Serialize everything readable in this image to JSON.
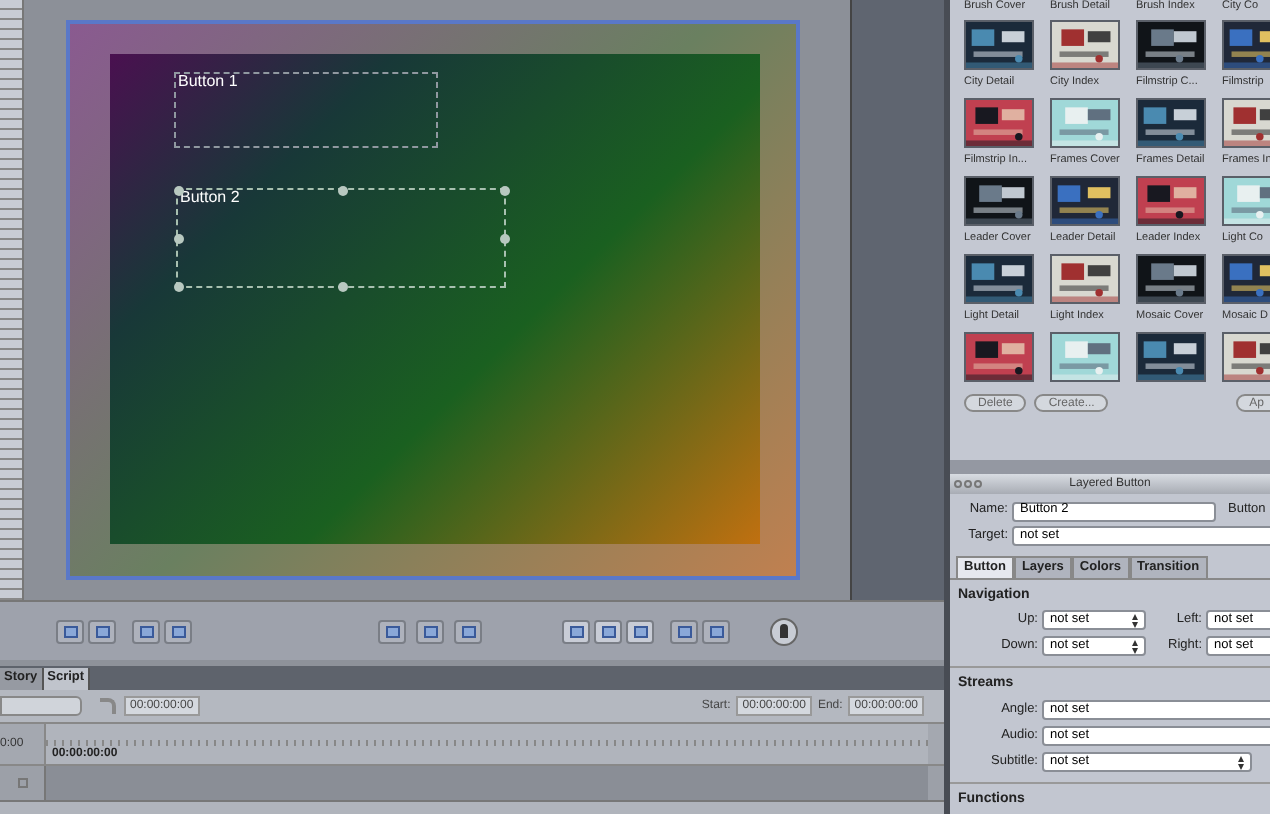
{
  "canvas": {
    "buttons": [
      {
        "label": "Button 1",
        "selected": false
      },
      {
        "label": "Button 2",
        "selected": true
      }
    ]
  },
  "timeline": {
    "tabs": [
      {
        "label": "Story",
        "selected": false
      },
      {
        "label": "Script",
        "selected": true
      }
    ],
    "timecode": "00:00:00:00",
    "start_label": "Start:",
    "start": "00:00:00:00",
    "end_label": "End:",
    "end": "00:00:00:00",
    "ruler_start": "0:00",
    "marker": "00:00:00:00"
  },
  "templates": {
    "header_labels": [
      "Brush Cover",
      "Brush Detail",
      "Brush Index",
      "City Co"
    ],
    "items": [
      {
        "kind": "labeled",
        "label": "City Detail"
      },
      {
        "kind": "labeled",
        "label": "City Index"
      },
      {
        "kind": "labeled",
        "label": "Filmstrip C..."
      },
      {
        "kind": "labeled",
        "label": "Filmstrip"
      },
      {
        "kind": "labeled",
        "label": "Filmstrip In..."
      },
      {
        "kind": "labeled",
        "label": "Frames Cover"
      },
      {
        "kind": "labeled",
        "label": "Frames Detail"
      },
      {
        "kind": "labeled",
        "label": "Frames In"
      },
      {
        "kind": "labeled",
        "label": "Leader Cover"
      },
      {
        "kind": "labeled",
        "label": "Leader Detail"
      },
      {
        "kind": "labeled",
        "label": "Leader Index"
      },
      {
        "kind": "labeled",
        "label": "Light Co"
      },
      {
        "kind": "labeled",
        "label": "Light Detail"
      },
      {
        "kind": "labeled",
        "label": "Light Index"
      },
      {
        "kind": "labeled",
        "label": "Mosaic Cover"
      },
      {
        "kind": "labeled",
        "label": "Mosaic D"
      },
      {
        "kind": "picture"
      },
      {
        "kind": "picture"
      },
      {
        "kind": "picture"
      },
      {
        "kind": "picture"
      }
    ],
    "buttons": [
      "Delete",
      "Create...",
      "Ap"
    ]
  },
  "inspector": {
    "title": "Layered Button",
    "name_label": "Name:",
    "name": "Button 2",
    "type_label": "Button",
    "target_label": "Target:",
    "target": "not set",
    "tabs": [
      {
        "label": "Button",
        "selected": true
      },
      {
        "label": "Layers",
        "selected": false
      },
      {
        "label": "Colors",
        "selected": false
      },
      {
        "label": "Transition",
        "selected": false
      }
    ],
    "navigation": {
      "title": "Navigation",
      "up_label": "Up:",
      "up": "not set",
      "left_label": "Left:",
      "left": "not set",
      "down_label": "Down:",
      "down": "not set",
      "right_label": "Right:",
      "right": "not set"
    },
    "streams": {
      "title": "Streams",
      "angle_label": "Angle:",
      "angle": "not set",
      "audio_label": "Audio:",
      "audio": "not set",
      "subtitle_label": "Subtitle:",
      "subtitle": "not set"
    },
    "functions_title": "Functions"
  }
}
